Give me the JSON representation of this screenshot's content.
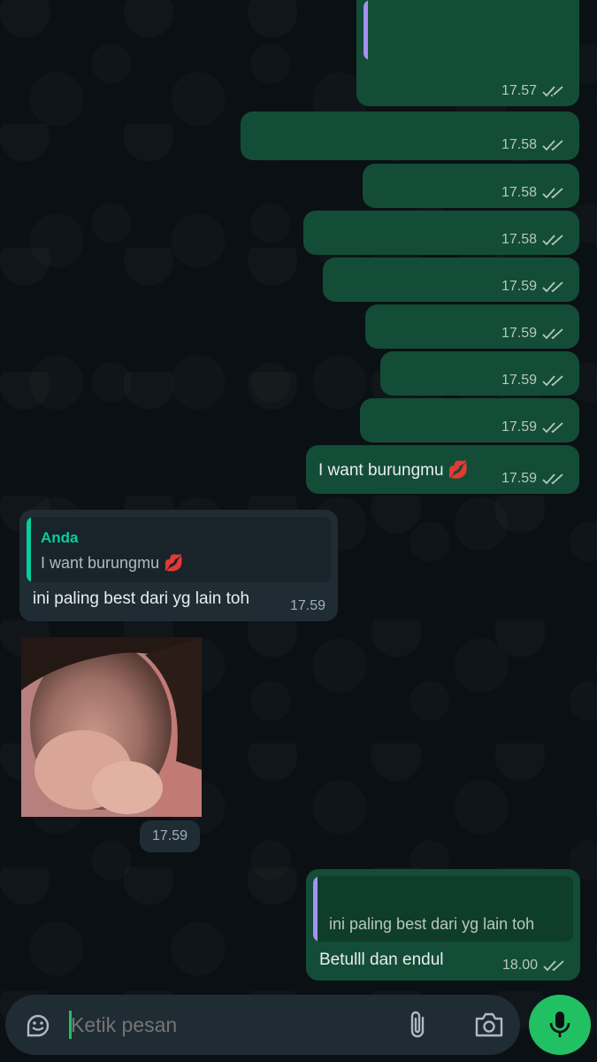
{
  "outgoing_times": [
    "17.57",
    "17.58",
    "17.58",
    "17.58",
    "17.59",
    "17.59",
    "17.59",
    "17.59"
  ],
  "msg_burung": {
    "text": "I want burungmu",
    "emoji": "💋",
    "time": "17.59"
  },
  "incoming_reply": {
    "quote_author": "Anda",
    "quote_text": "I want burungmu",
    "quote_emoji": "💋",
    "text": "ini paling best dari yg lain toh",
    "time": "17.59"
  },
  "incoming_photo": {
    "time": "17.59"
  },
  "last_outgoing": {
    "quote_text": "ini paling best dari yg lain toh",
    "text": "Betulll dan endul",
    "time": "18.00"
  },
  "composer": {
    "placeholder": "Ketik pesan"
  },
  "icons": [
    "sticker-icon",
    "attach-icon",
    "camera-icon",
    "mic-icon",
    "double-check-icon"
  ],
  "colors": {
    "outgoing_bubble": "#134d37",
    "incoming_bubble": "#1f2c34",
    "accent_green": "#21c063",
    "quote_author": "#06cf9c"
  }
}
